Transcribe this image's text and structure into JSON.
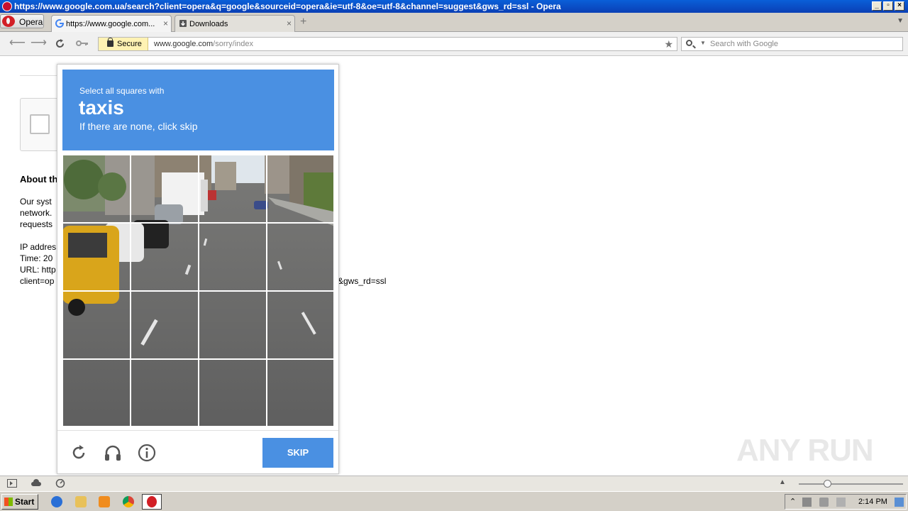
{
  "window": {
    "title": "https://www.google.com.ua/search?client=opera&q=google&sourceid=opera&ie=utf-8&oe=utf-8&channel=suggest&gws_rd=ssl - Opera",
    "buttons": [
      "_",
      "▫",
      "×"
    ]
  },
  "tabs": {
    "opera_menu": "Opera",
    "items": [
      {
        "label": "https://www.google.com...",
        "close": "×"
      },
      {
        "label": "Downloads",
        "close": "×"
      }
    ],
    "new_tab": "+"
  },
  "address": {
    "secure_label": "Secure",
    "url_domain": "www.google.com",
    "url_path": "/sorry/index",
    "search_placeholder": "Search with Google"
  },
  "page": {
    "about_heading": "About th",
    "lines": [
      "Our syst",
      "network.",
      "requests",
      "IP addres",
      "Time: 20",
      "URL: http",
      "client=op"
    ],
    "url_tail": "&gws_rd=ssl"
  },
  "captcha": {
    "instruction_line1": "Select all squares with",
    "target": "taxis",
    "instruction_line2": "If there are none, click skip",
    "skip_label": "SKIP",
    "icons": [
      "reload-icon",
      "headphones-icon",
      "info-icon"
    ]
  },
  "taskbar": {
    "start_label": "Start",
    "clock": "2:14 PM"
  },
  "watermark": "ANY RUN"
}
